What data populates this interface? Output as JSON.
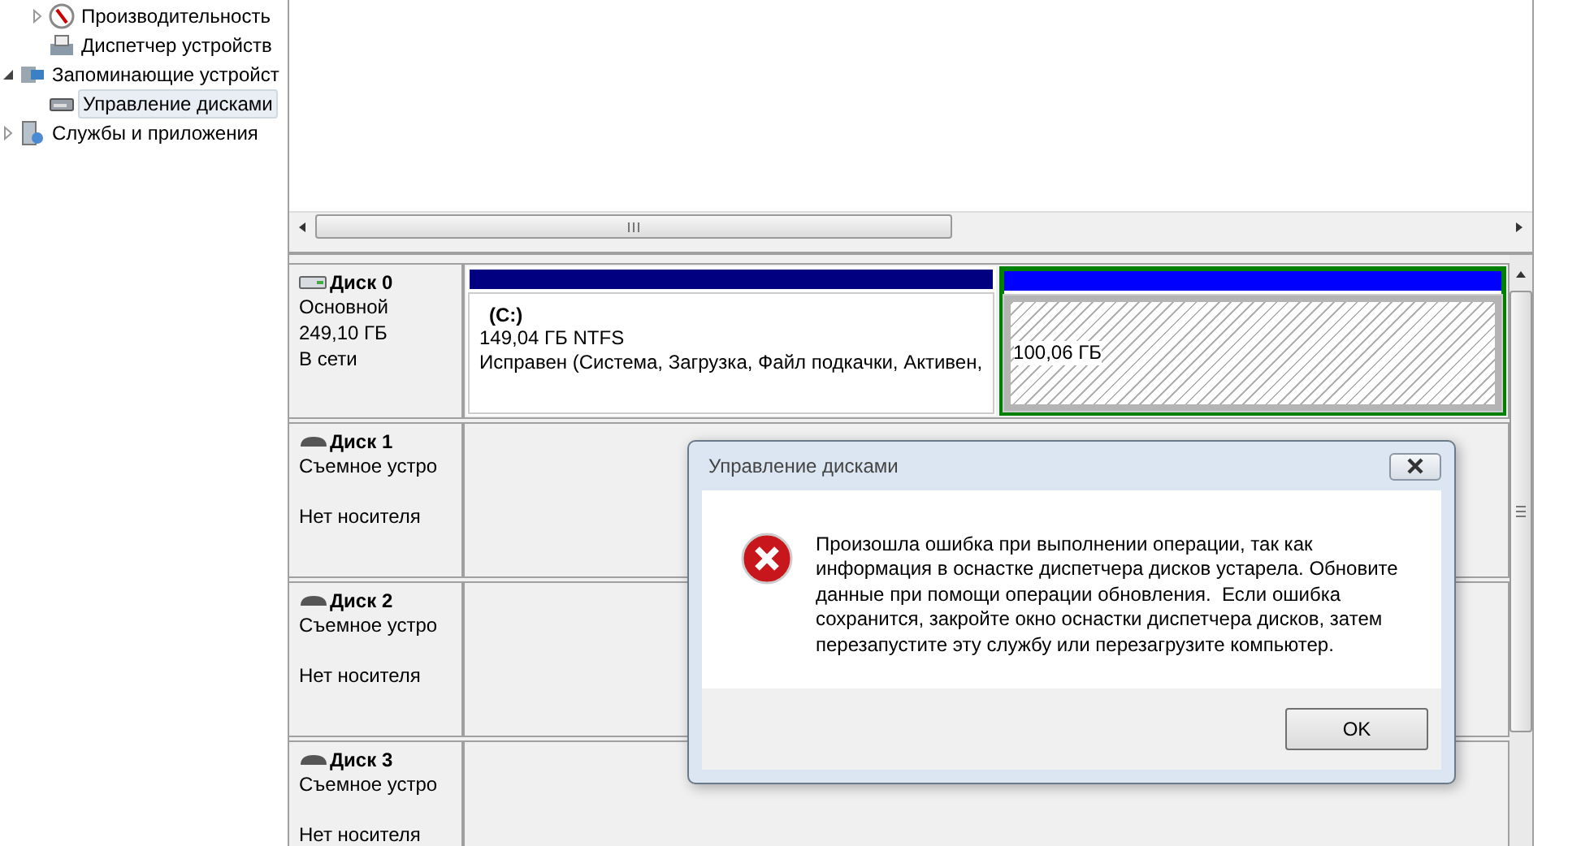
{
  "tree": {
    "upper_items": [
      {
        "label": "Производительность",
        "expanded": false
      },
      {
        "label": "Диспетчер устройств"
      }
    ],
    "items": [
      {
        "label": "Запоминающие устройст",
        "expanded": true,
        "children": [
          {
            "label": "Управление дисками",
            "selected": true
          }
        ]
      },
      {
        "label": "Службы и приложения",
        "expanded": false
      }
    ]
  },
  "disks": [
    {
      "name": "Диск 0",
      "kind": "basic",
      "lines": [
        "Основной",
        "249,10 ГБ",
        "В сети"
      ],
      "partitions": [
        {
          "kind": "primary",
          "title": "(C:)",
          "lines": [
            "149,04 ГБ NTFS",
            "Исправен (Система, Загрузка, Файл подкачки, Активен,"
          ],
          "selected": false
        },
        {
          "kind": "unallocated",
          "lines": [
            "100,06 ГБ"
          ],
          "selected": true
        }
      ]
    },
    {
      "name": "Диск 1",
      "kind": "removable",
      "lines": [
        "Съемное устро",
        "Нет носителя"
      ]
    },
    {
      "name": "Диск 2",
      "kind": "removable",
      "lines": [
        "Съемное устро",
        "Нет носителя"
      ]
    },
    {
      "name": "Диск 3",
      "kind": "removable",
      "lines": [
        "Съемное устро",
        "Нет носителя"
      ]
    }
  ],
  "dialog": {
    "title": "Управление дисками",
    "message": "Произошла ошибка при выполнении операции, так как информация в оснастке диспетчера дисков устарела. Обновите данные при помощи операции обновления.  Если ошибка сохранится, закройте окно оснастки диспетчера дисков, затем перезапустите эту службу или перезагрузите компьютер.",
    "buttons": [
      "OK"
    ]
  }
}
